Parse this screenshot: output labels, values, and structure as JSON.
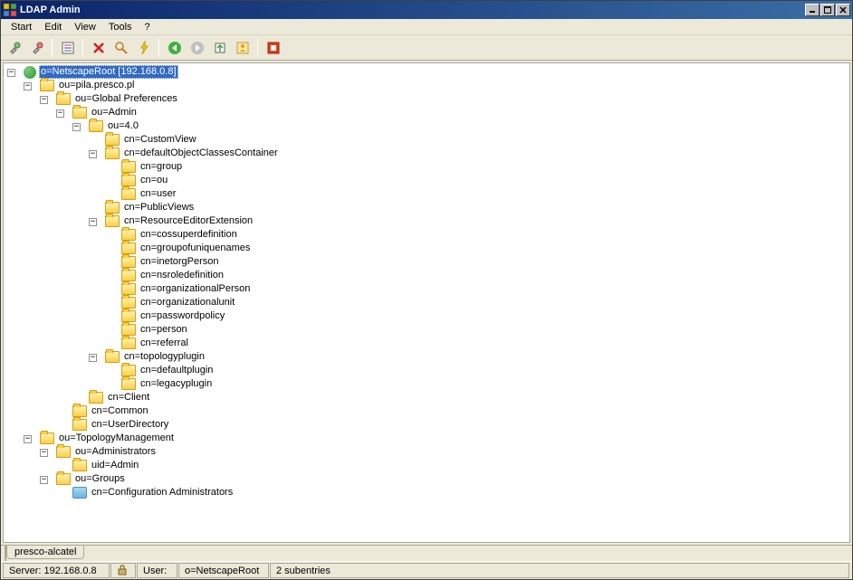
{
  "window": {
    "title": "LDAP Admin"
  },
  "menu": {
    "start": "Start",
    "edit": "Edit",
    "view": "View",
    "tools": "Tools",
    "help": "?"
  },
  "toolbar_icons": {
    "connect": "connect-icon",
    "refresh": "refresh-icon",
    "edit": "edit-icon",
    "delete": "delete-icon",
    "search": "search-icon",
    "flash": "flash-icon",
    "back": "back-icon",
    "forward": "forward-icon",
    "export": "export-icon",
    "tree": "tree-icon",
    "stop": "stop-icon"
  },
  "tree": {
    "root": {
      "label": "o=NetscapeRoot [192.168.0.8]",
      "children": {
        "pila": {
          "label": "ou=pila.presco.pl",
          "children": {
            "globalpref": {
              "label": "ou=Global Preferences",
              "children": {
                "admin": {
                  "label": "ou=Admin",
                  "children": {
                    "v40": {
                      "label": "ou=4.0",
                      "children": {
                        "customview": {
                          "label": "cn=CustomView"
                        },
                        "defobjclass": {
                          "label": "cn=defaultObjectClassesContainer",
                          "children": {
                            "group": {
                              "label": "cn=group"
                            },
                            "ou": {
                              "label": "cn=ou"
                            },
                            "user": {
                              "label": "cn=user"
                            }
                          }
                        },
                        "publicviews": {
                          "label": "cn=PublicViews"
                        },
                        "reseditor": {
                          "label": "cn=ResourceEditorExtension",
                          "children": {
                            "cossuper": {
                              "label": "cn=cossuperdefinition"
                            },
                            "groupunique": {
                              "label": "cn=groupofuniquenames"
                            },
                            "inetorg": {
                              "label": "cn=inetorgPerson"
                            },
                            "nsrole": {
                              "label": "cn=nsroledefinition"
                            },
                            "orgperson": {
                              "label": "cn=organizationalPerson"
                            },
                            "orgunit": {
                              "label": "cn=organizationalunit"
                            },
                            "pwdpolicy": {
                              "label": "cn=passwordpolicy"
                            },
                            "person": {
                              "label": "cn=person"
                            },
                            "referral": {
                              "label": "cn=referral"
                            }
                          }
                        },
                        "topoplugin": {
                          "label": "cn=topologyplugin",
                          "children": {
                            "defplugin": {
                              "label": "cn=defaultplugin"
                            },
                            "legplugin": {
                              "label": "cn=legacyplugin"
                            }
                          }
                        }
                      }
                    },
                    "client": {
                      "label": "cn=Client"
                    }
                  }
                },
                "common": {
                  "label": "cn=Common"
                },
                "userdir": {
                  "label": "cn=UserDirectory"
                }
              }
            }
          }
        },
        "topomgmt": {
          "label": "ou=TopologyManagement",
          "children": {
            "admins": {
              "label": "ou=Administrators",
              "children": {
                "uidadmin": {
                  "label": "uid=Admin"
                }
              }
            },
            "groups": {
              "label": "ou=Groups",
              "children": {
                "confadmins": {
                  "label": "cn=Configuration Administrators"
                }
              }
            }
          }
        }
      }
    }
  },
  "tabs": {
    "tab1": "presco-alcatel"
  },
  "status": {
    "server": "Server: 192.168.0.8",
    "user_label": "User:",
    "context": "o=NetscapeRoot",
    "subentries": "2 subentries"
  }
}
